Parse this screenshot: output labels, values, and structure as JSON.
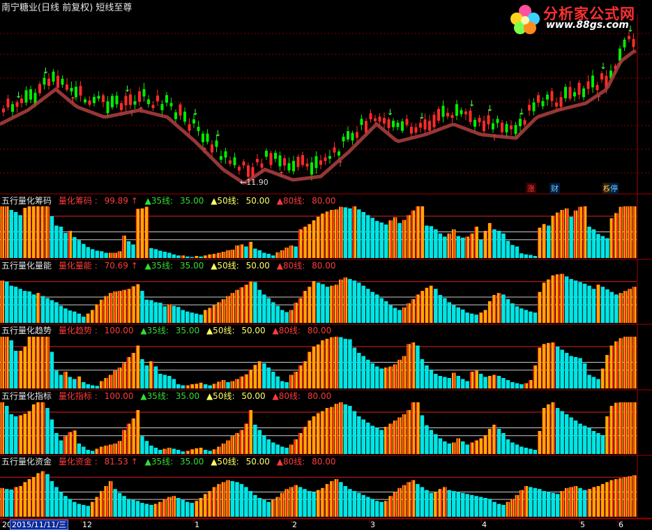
{
  "header": {
    "title": "南宁糖业(日线 前复权) 短线至尊",
    "logo_brand": "分析家公式网",
    "logo_site": "www.88gs.com"
  },
  "price_chart": {
    "low_label": "←11.90",
    "low_value": 11.9,
    "markers": [
      "涨",
      "财",
      "权",
      "停"
    ]
  },
  "x_axis": {
    "date_label": "2015/11/11/三",
    "ticks": [
      "20",
      "12",
      "1",
      "2",
      "3",
      "4",
      "5",
      "6"
    ]
  },
  "colors": {
    "background": "#000000",
    "grid": "#8b0000",
    "up_candle": "#ff2a2a",
    "down_candle": "#00ee00",
    "bar_hot": "#ffaa00",
    "bar_stripe": "#ff1e1e",
    "bar_cold": "#00e6e6",
    "ma_line": "#b04040"
  },
  "chart_data": [
    {
      "type": "bar",
      "panel": "筹码",
      "label": "五行量化筹码",
      "series_label": "量化筹码",
      "current": "99.89",
      "arrow": "↑",
      "lines": [
        {
          "label": "▲35线",
          "value": "35.00",
          "level": 35
        },
        {
          "label": "▲50线",
          "value": "50.00",
          "level": 50
        },
        {
          "label": "▲80线",
          "value": "80.00",
          "level": 80
        }
      ],
      "ylim": [
        0,
        100
      ],
      "values": [
        99,
        99,
        92,
        88,
        82,
        96,
        99,
        99,
        99,
        99,
        99,
        80,
        62,
        60,
        48,
        52,
        40,
        34,
        27,
        21,
        17,
        14,
        13,
        10,
        10,
        10,
        13,
        43,
        32,
        26,
        94,
        95,
        98,
        19,
        17,
        14,
        12,
        10,
        7,
        5,
        5,
        3,
        2,
        4,
        3,
        5,
        7,
        8,
        10,
        12,
        15,
        16,
        24,
        26,
        22,
        31,
        18,
        15,
        10,
        8,
        5,
        11,
        15,
        20,
        24,
        22,
        55,
        60,
        65,
        72,
        79,
        85,
        89,
        92,
        93,
        98,
        97,
        95,
        99,
        93,
        88,
        82,
        77,
        71,
        68,
        64,
        72,
        78,
        67,
        73,
        82,
        91,
        99,
        99,
        62,
        61,
        55,
        47,
        41,
        47,
        55,
        42,
        39,
        41,
        47,
        60,
        35,
        52,
        67,
        55,
        52,
        47,
        33,
        25,
        22,
        9,
        7,
        6,
        4,
        58,
        65,
        62,
        81,
        87,
        92,
        95,
        79,
        91,
        98,
        99,
        60,
        55,
        46,
        42,
        38,
        76,
        86,
        98,
        99,
        99,
        99
      ]
    },
    {
      "type": "bar",
      "panel": "量能",
      "label": "五行量化量能",
      "series_label": "量化量能",
      "current": "70.69",
      "arrow": "↑",
      "lines": [
        {
          "label": "▲35线",
          "value": "35.00",
          "level": 35
        },
        {
          "label": "▲50线",
          "value": "50.00",
          "level": 50
        },
        {
          "label": "▲80线",
          "value": "80.00",
          "level": 80
        }
      ],
      "ylim": [
        0,
        100
      ],
      "values": [
        82,
        80,
        72,
        70,
        66,
        62,
        61,
        55,
        58,
        52,
        48,
        44,
        40,
        33,
        28,
        24,
        22,
        18,
        12,
        18,
        25,
        36,
        45,
        52,
        58,
        61,
        62,
        64,
        66,
        71,
        75,
        62,
        45,
        44,
        40,
        39,
        32,
        36,
        33,
        31,
        25,
        22,
        20,
        18,
        16,
        25,
        29,
        34,
        40,
        46,
        52,
        58,
        64,
        69,
        74,
        80,
        79,
        64,
        55,
        48,
        40,
        33,
        25,
        21,
        25,
        39,
        48,
        62,
        70,
        81,
        78,
        75,
        70,
        72,
        74,
        84,
        88,
        85,
        82,
        78,
        72,
        66,
        60,
        55,
        48,
        42,
        34,
        29,
        25,
        30,
        38,
        46,
        55,
        62,
        68,
        72,
        66,
        54,
        48,
        40,
        34,
        30,
        26,
        20,
        18,
        16,
        20,
        25,
        42,
        54,
        58,
        55,
        46,
        38,
        32,
        28,
        25,
        22,
        20,
        60,
        78,
        84,
        92,
        94,
        95,
        90,
        85,
        82,
        79,
        76,
        72,
        66,
        74,
        70,
        65,
        60,
        55,
        58,
        62,
        66,
        70
      ]
    },
    {
      "type": "bar",
      "panel": "趋势",
      "label": "五行量化趋势",
      "series_label": "量化趋势",
      "current": "100.00",
      "arrow": "",
      "lines": [
        {
          "label": "▲35线",
          "value": "35.00",
          "level": 35
        },
        {
          "label": "▲50线",
          "value": "50.00",
          "level": 50
        },
        {
          "label": "▲80线",
          "value": "80.00",
          "level": 80
        }
      ],
      "ylim": [
        0,
        100
      ],
      "values": [
        99,
        99,
        92,
        72,
        72,
        80,
        99,
        99,
        99,
        99,
        99,
        70,
        34,
        26,
        32,
        22,
        18,
        23,
        12,
        8,
        6,
        5,
        14,
        20,
        26,
        34,
        40,
        49,
        60,
        68,
        82,
        56,
        44,
        52,
        42,
        28,
        26,
        24,
        18,
        8,
        6,
        6,
        8,
        9,
        11,
        8,
        6,
        9,
        13,
        16,
        12,
        14,
        18,
        23,
        27,
        36,
        45,
        52,
        48,
        40,
        32,
        23,
        14,
        12,
        26,
        32,
        44,
        52,
        70,
        80,
        84,
        92,
        95,
        98,
        99,
        98,
        95,
        94,
        78,
        68,
        62,
        55,
        48,
        42,
        38,
        40,
        42,
        46,
        55,
        62,
        85,
        88,
        82,
        56,
        44,
        36,
        28,
        24,
        22,
        20,
        30,
        24,
        18,
        14,
        32,
        34,
        28,
        22,
        24,
        26,
        24,
        20,
        16,
        12,
        10,
        8,
        10,
        16,
        44,
        78,
        85,
        87,
        88,
        80,
        74,
        68,
        62,
        60,
        58,
        48,
        26,
        22,
        18,
        38,
        64,
        82,
        90,
        96,
        99,
        99,
        99
      ]
    },
    {
      "type": "bar",
      "panel": "指标",
      "label": "五行量化指标",
      "series_label": "量化指标",
      "current": "100.00",
      "arrow": "",
      "lines": [
        {
          "label": "▲35线",
          "value": "35.00",
          "level": 35
        },
        {
          "label": "▲50线",
          "value": "50.00",
          "level": 50
        },
        {
          "label": "▲80线",
          "value": "80.00",
          "level": 80
        }
      ],
      "ylim": [
        0,
        100
      ],
      "values": [
        99,
        92,
        76,
        72,
        74,
        77,
        82,
        95,
        99,
        99,
        88,
        66,
        40,
        26,
        34,
        42,
        45,
        20,
        14,
        8,
        6,
        10,
        14,
        16,
        18,
        20,
        25,
        46,
        58,
        68,
        84,
        34,
        25,
        16,
        12,
        8,
        10,
        12,
        10,
        8,
        5,
        6,
        9,
        11,
        12,
        8,
        6,
        9,
        14,
        20,
        26,
        34,
        40,
        46,
        58,
        84,
        56,
        46,
        36,
        28,
        22,
        18,
        14,
        12,
        18,
        28,
        40,
        52,
        64,
        72,
        78,
        82,
        88,
        90,
        96,
        99,
        95,
        92,
        82,
        72,
        66,
        60,
        54,
        50,
        46,
        52,
        58,
        64,
        70,
        76,
        84,
        99,
        99,
        74,
        55,
        46,
        38,
        30,
        24,
        20,
        22,
        30,
        24,
        18,
        22,
        26,
        30,
        36,
        48,
        56,
        48,
        40,
        28,
        22,
        18,
        14,
        12,
        10,
        8,
        44,
        88,
        95,
        99,
        88,
        82,
        76,
        70,
        64,
        58,
        54,
        50,
        44,
        40,
        36,
        72,
        92,
        98,
        99,
        99,
        99,
        99
      ]
    },
    {
      "type": "bar",
      "panel": "资金",
      "label": "五行量化资金",
      "series_label": "量化资金",
      "current": "81.53",
      "arrow": "↑",
      "lines": [
        {
          "label": "▲35线",
          "value": "35.00",
          "level": 35
        },
        {
          "label": "▲50线",
          "value": "50.00",
          "level": 50
        },
        {
          "label": "▲80线",
          "value": "80.00",
          "level": 80
        }
      ],
      "ylim": [
        0,
        100
      ],
      "values": [
        58,
        56,
        55,
        60,
        62,
        70,
        76,
        80,
        88,
        92,
        86,
        72,
        60,
        50,
        42,
        36,
        30,
        26,
        24,
        22,
        30,
        40,
        52,
        62,
        72,
        56,
        48,
        42,
        36,
        34,
        32,
        28,
        26,
        24,
        26,
        30,
        36,
        40,
        42,
        38,
        34,
        30,
        28,
        32,
        38,
        46,
        52,
        60,
        66,
        70,
        74,
        72,
        70,
        66,
        60,
        52,
        44,
        38,
        34,
        30,
        34,
        40,
        48,
        56,
        60,
        64,
        60,
        56,
        52,
        50,
        54,
        58,
        66,
        72,
        76,
        70,
        62,
        56,
        52,
        48,
        44,
        40,
        36,
        32,
        30,
        32,
        42,
        50,
        58,
        64,
        70,
        74,
        66,
        60,
        54,
        48,
        50,
        56,
        60,
        54,
        52,
        50,
        48,
        46,
        44,
        42,
        40,
        38,
        36,
        30,
        26,
        24,
        30,
        36,
        44,
        54,
        62,
        60,
        58,
        56,
        52,
        50,
        48,
        46,
        52,
        58,
        60,
        62,
        58,
        54,
        56,
        60,
        62,
        66,
        70,
        74,
        76,
        78,
        80,
        82,
        84
      ]
    }
  ]
}
